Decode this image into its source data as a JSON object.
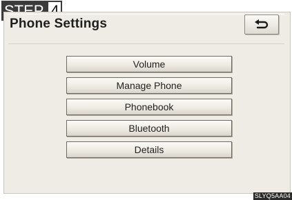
{
  "step": {
    "label": "STEP",
    "number": "4"
  },
  "header": {
    "title": "Phone Settings"
  },
  "back_button": {
    "icon": "back-arrow-icon"
  },
  "menu": [
    {
      "label": "Volume"
    },
    {
      "label": "Manage Phone"
    },
    {
      "label": "Phonebook"
    },
    {
      "label": "Bluetooth"
    },
    {
      "label": "Details"
    }
  ],
  "image_code": "SLYQ5AA04",
  "colors": {
    "screen_bg": "#eeece4",
    "step_bg": "#3b3b3b",
    "button_border": "#6e6b63"
  }
}
